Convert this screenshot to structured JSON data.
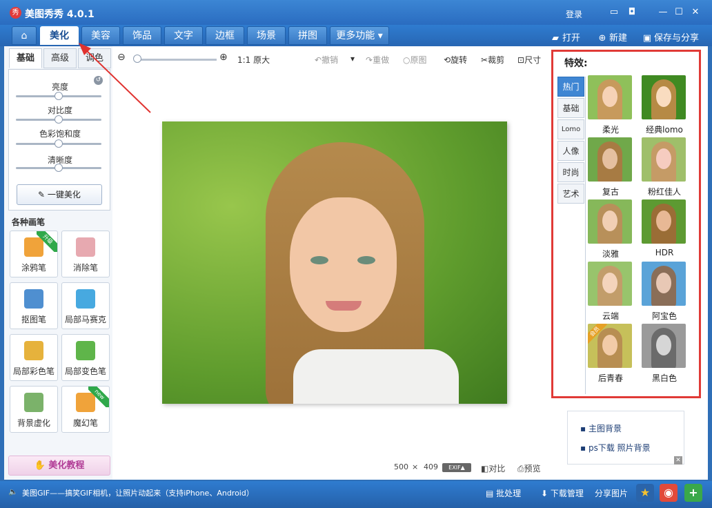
{
  "app": {
    "logo_glyph": "秀",
    "title": "美图秀秀 4.0.1",
    "login": "登录"
  },
  "window_controls": [
    "feedback-icon",
    "skin-icon",
    "minimize-icon",
    "maximize-icon",
    "close-icon"
  ],
  "nav": {
    "tabs": [
      "美化",
      "美容",
      "饰品",
      "文字",
      "边框",
      "场景",
      "拼图",
      "更多功能"
    ],
    "active_tab": "美化",
    "open": "打开",
    "new": "新建",
    "save_share": "保存与分享"
  },
  "left_panel": {
    "tabs": [
      "基础",
      "高级",
      "调色"
    ],
    "active_tab": "基础",
    "sliders": [
      {
        "label": "亮度",
        "value": 0.5
      },
      {
        "label": "对比度",
        "value": 0.5
      },
      {
        "label": "色彩饱和度",
        "value": 0.5
      },
      {
        "label": "清晰度",
        "value": 0.5
      }
    ],
    "one_key": "一键美化",
    "brush_title": "各种画笔",
    "brushes": [
      {
        "label": "涂鸦笔",
        "tag": "升级",
        "color": "#f0a33a"
      },
      {
        "label": "消除笔",
        "tag": "",
        "color": "#e7a9b0"
      },
      {
        "label": "抠图笔",
        "tag": "",
        "color": "#4f8fd0"
      },
      {
        "label": "局部马赛克",
        "tag": "",
        "color": "#47a9e0"
      },
      {
        "label": "局部彩色笔",
        "tag": "",
        "color": "#e6b23c"
      },
      {
        "label": "局部变色笔",
        "tag": "",
        "color": "#5fb54a"
      },
      {
        "label": "背景虚化",
        "tag": "",
        "color": "#7bb26a"
      },
      {
        "label": "魔幻笔",
        "tag": "new",
        "color": "#f0a33a"
      }
    ],
    "tutorial": "美化教程"
  },
  "toolbar": {
    "original_size": "1:1 原大",
    "undo": "撤销",
    "redo": "重做",
    "original": "原图",
    "rotate": "旋转",
    "crop": "裁剪",
    "size": "尺寸"
  },
  "canvas": {
    "width_text": "500",
    "times": "×",
    "height_text": "409",
    "exif": "EXIF▲",
    "compare": "对比",
    "preview": "预览"
  },
  "effects": {
    "title": "特效:",
    "categories": [
      "热门",
      "基础",
      "Lomo",
      "人像",
      "时尚",
      "艺术"
    ],
    "active_category": "热门",
    "items": [
      {
        "label": "柔光",
        "bg": "#8fc05a",
        "hair": "#c79a5c",
        "face": "#f6d2b6",
        "tag": ""
      },
      {
        "label": "经典lomo",
        "bg": "#3f8a22",
        "hair": "#b68a45",
        "face": "#f9dcc0",
        "tag": ""
      },
      {
        "label": "复古",
        "bg": "#70a84a",
        "hair": "#a77b43",
        "face": "#e5c0a0",
        "tag": ""
      },
      {
        "label": "粉红佳人",
        "bg": "#9fbf6a",
        "hair": "#c59b66",
        "face": "#f6ccc0",
        "tag": ""
      },
      {
        "label": "淡雅",
        "bg": "#86b85a",
        "hair": "#b8905a",
        "face": "#f1cfb4",
        "tag": ""
      },
      {
        "label": "HDR",
        "bg": "#5d9a32",
        "hair": "#9a6d36",
        "face": "#e8b895",
        "tag": ""
      },
      {
        "label": "云端",
        "bg": "#98c46c",
        "hair": "#c29d6a",
        "face": "#f4d4bc",
        "tag": ""
      },
      {
        "label": "阿宝色",
        "bg": "#5aa3d8",
        "hair": "#8a6e58",
        "face": "#e8c8b5",
        "tag": ""
      },
      {
        "label": "后青春",
        "bg": "#c6c05a",
        "hair": "#b88e52",
        "face": "#f2cba8",
        "tag": "会员"
      },
      {
        "label": "黑白色",
        "bg": "#9a9a9a",
        "hair": "#6b6b6b",
        "face": "#d6d6d6",
        "tag": ""
      }
    ]
  },
  "ad": {
    "items": [
      "主图背景",
      "ps下载  照片背景"
    ]
  },
  "statusbar": {
    "marquee": "美图GIF——搞笑GIF相机，让照片动起来（支持iPhone、Android）",
    "batch": "批处理",
    "download_mgr": "下载管理",
    "share_pic": "分享图片"
  },
  "colors": {
    "accent": "#2f6fb7",
    "highlight_border": "#e03a36"
  }
}
